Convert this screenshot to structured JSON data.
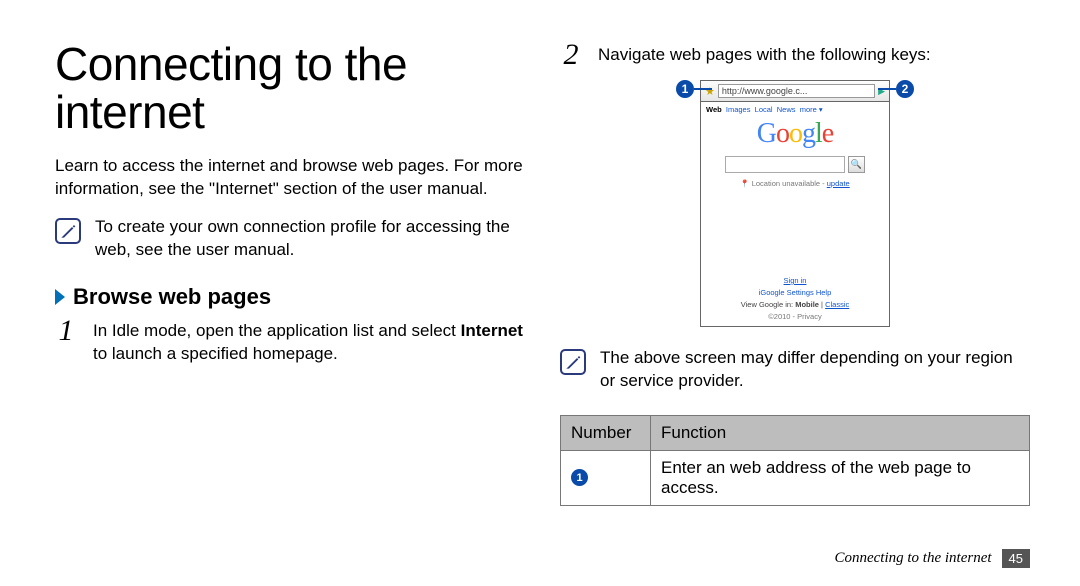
{
  "title": "Connecting to the internet",
  "intro": "Learn to access the internet and browse web pages. For more information, see the \"Internet\" section of the user manual.",
  "note1": "To create your own connection profile for accessing the web, see the user manual.",
  "section_heading": "Browse web pages",
  "steps": [
    {
      "num": "1",
      "text_before": "In Idle mode, open the application list and select ",
      "bold": "Internet",
      "text_after": " to launch a specified homepage."
    },
    {
      "num": "2",
      "text": "Navigate web pages with the following keys:"
    }
  ],
  "screenshot": {
    "url": "http://www.google.c...",
    "tabs": [
      "Web",
      "Images",
      "Local",
      "News",
      "more ▾"
    ],
    "logo_letters": [
      "G",
      "o",
      "o",
      "g",
      "l",
      "e"
    ],
    "location_text": "Location unavailable",
    "location_link": "update",
    "signin": "Sign in",
    "links_row2": "iGoogle   Settings   Help",
    "view_line_prefix": "View Google in: ",
    "view_bold": "Mobile",
    "view_sep": " | ",
    "view_link": "Classic",
    "copyright": "©2010 - Privacy"
  },
  "callouts": {
    "left": "1",
    "right": "2"
  },
  "note2": "The above screen may differ depending on your region or service provider.",
  "table": {
    "head": [
      "Number",
      "Function"
    ],
    "rows": [
      {
        "num_badge": "1",
        "func": "Enter an web address of the web page to access."
      }
    ]
  },
  "footer": {
    "text": "Connecting to the internet",
    "page": "45"
  }
}
